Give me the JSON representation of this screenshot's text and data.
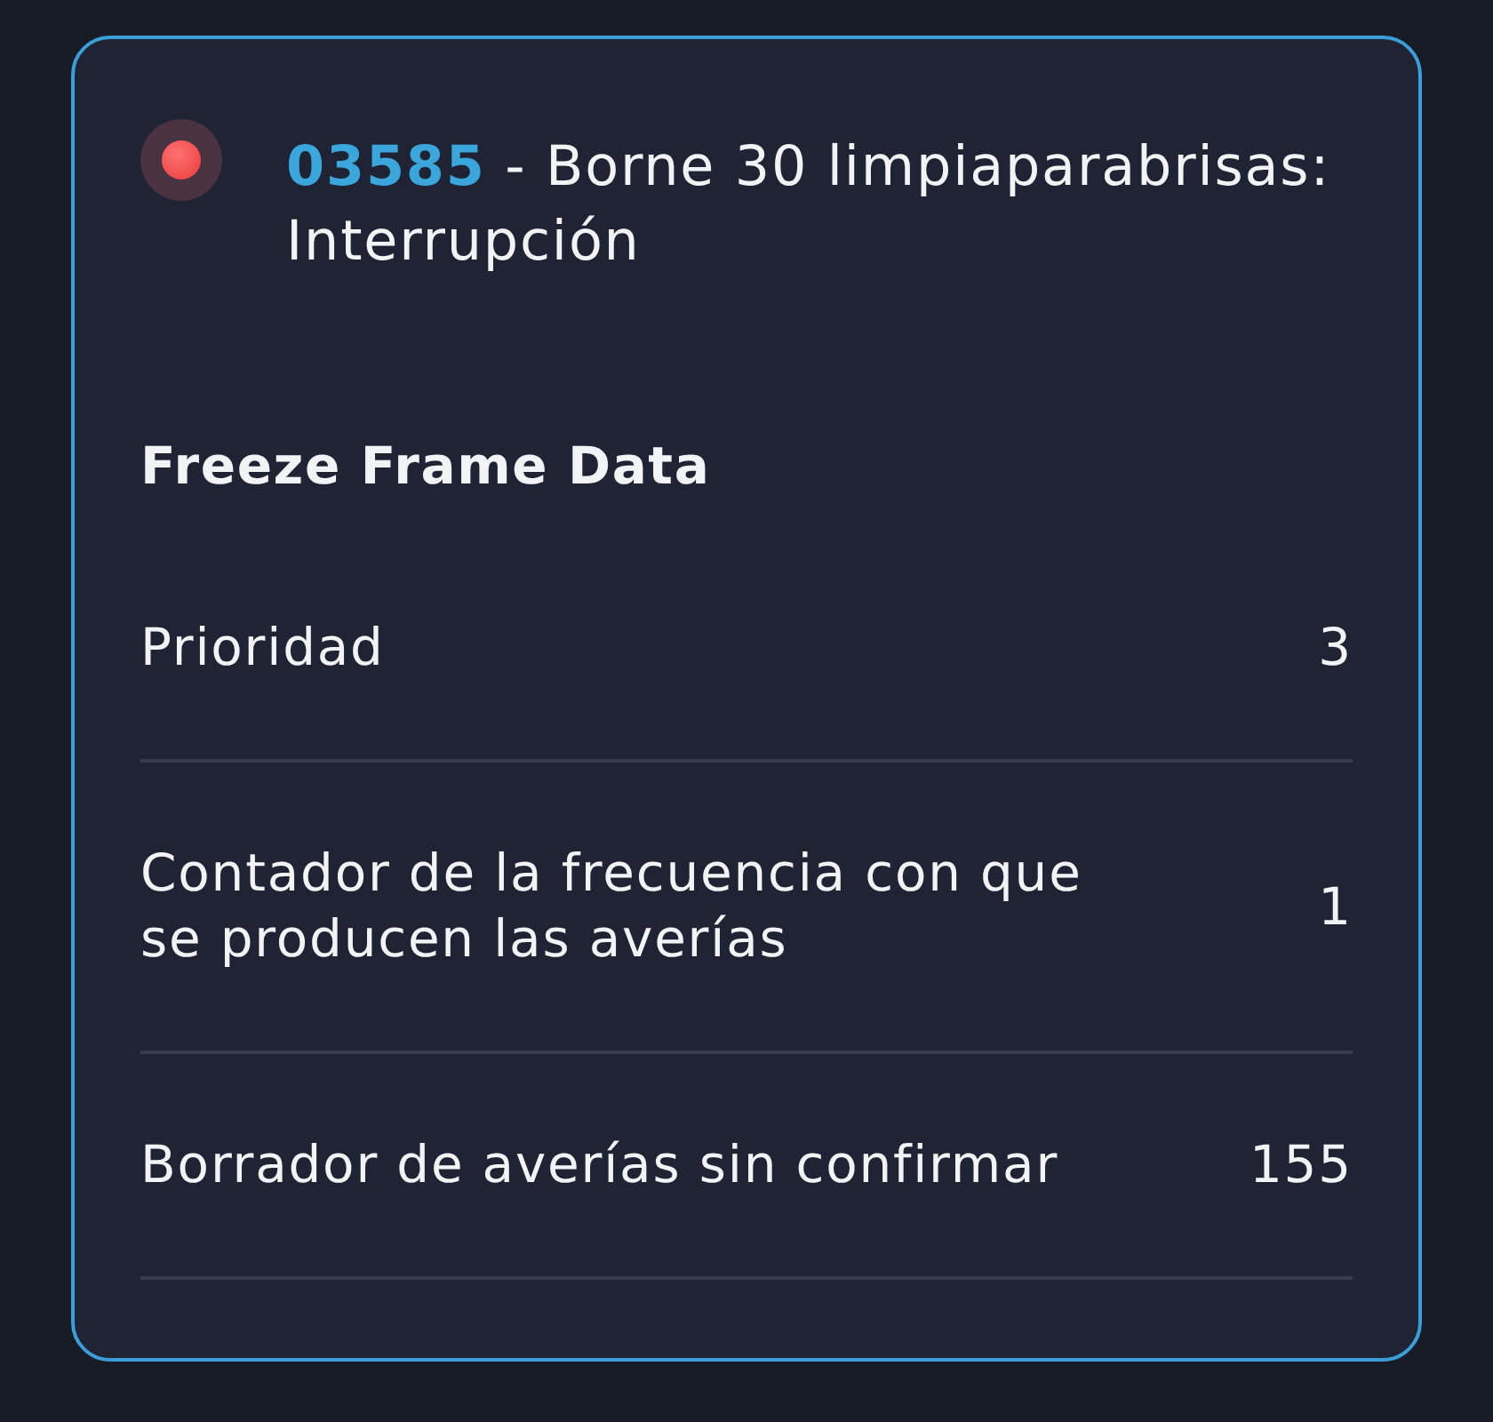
{
  "fault": {
    "code": "03585",
    "description": "- Borne 30 limpiaparabrisas: Interrupción"
  },
  "freeze_frame": {
    "title": "Freeze Frame Data",
    "rows": [
      {
        "label": "Prioridad",
        "value": "3"
      },
      {
        "label": "Contador de la frecuencia con que se producen las averías",
        "value": "1"
      },
      {
        "label": "Borrador de averías sin confirmar",
        "value": "155"
      }
    ]
  }
}
